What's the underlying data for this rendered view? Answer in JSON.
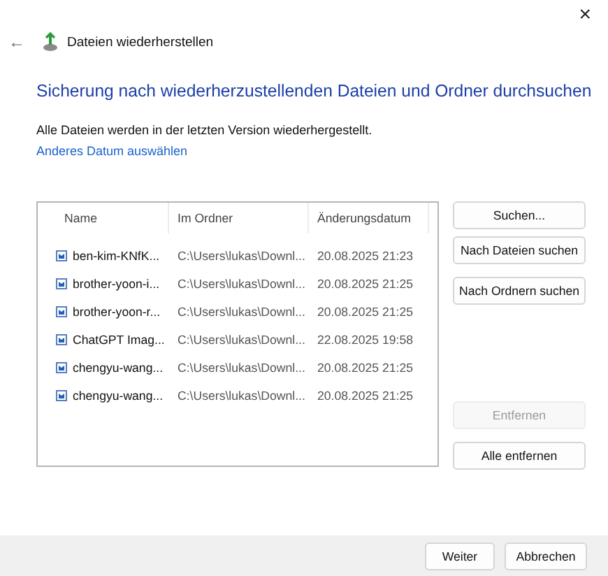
{
  "window": {
    "close": "×",
    "back": "←",
    "title": "Dateien wiederherstellen"
  },
  "heading": "Sicherung nach wiederherzustellenden Dateien und Ordner durchsuchen",
  "description": "Alle Dateien werden in der letzten Version wiederhergestellt.",
  "link": "Anderes Datum auswählen",
  "table": {
    "columns": [
      "Name",
      "Im Ordner",
      "Änderungsdatum"
    ],
    "rows": [
      {
        "name": "ben-kim-KNfK...",
        "folder": "C:\\Users\\lukas\\Downl...",
        "date": "20.08.2025 21:23"
      },
      {
        "name": "brother-yoon-i...",
        "folder": "C:\\Users\\lukas\\Downl...",
        "date": "20.08.2025 21:25"
      },
      {
        "name": "brother-yoon-r...",
        "folder": "C:\\Users\\lukas\\Downl...",
        "date": "20.08.2025 21:25"
      },
      {
        "name": "ChatGPT Imag...",
        "folder": "C:\\Users\\lukas\\Downl...",
        "date": "22.08.2025 19:58"
      },
      {
        "name": "chengyu-wang...",
        "folder": "C:\\Users\\lukas\\Downl...",
        "date": "20.08.2025 21:25"
      },
      {
        "name": "chengyu-wang...",
        "folder": "C:\\Users\\lukas\\Downl...",
        "date": "20.08.2025 21:25"
      }
    ]
  },
  "search_buttons": [
    {
      "label": "Suchen...",
      "disabled": false
    },
    {
      "label": "Nach Dateien suchen",
      "disabled": false
    },
    {
      "label": "Nach Ordnern suchen",
      "disabled": false
    }
  ],
  "remove_buttons": [
    {
      "label": "Entfernen",
      "disabled": true
    },
    {
      "label": "Alle entfernen",
      "disabled": false
    }
  ],
  "footer_buttons": [
    "Weiter",
    "Abbrechen"
  ]
}
